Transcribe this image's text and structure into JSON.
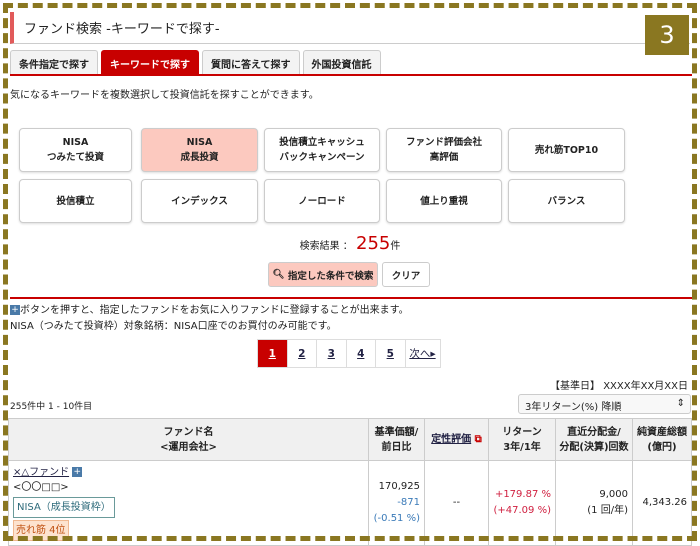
{
  "header": {
    "title": "ファンド検索 -キーワードで探す-",
    "badge": "3"
  },
  "tabs": [
    "条件指定で探す",
    "キーワードで探す",
    "質問に答えて探す",
    "外国投資信託"
  ],
  "description": "気になるキーワードを複数選択して投資信託を探すことができます。",
  "keywords": [
    {
      "l1": "NISA",
      "l2": "つみたて投資",
      "selected": false
    },
    {
      "l1": "NISA",
      "l2": "成長投資",
      "selected": true
    },
    {
      "l1": "投信積立キャッシュ",
      "l2": "バックキャンペーン",
      "selected": false
    },
    {
      "l1": "ファンド評価会社",
      "l2": "高評価",
      "selected": false
    },
    {
      "l1": "売れ筋TOP10",
      "l2": "",
      "selected": false
    },
    {
      "l1": "投信積立",
      "l2": "",
      "selected": false
    },
    {
      "l1": "インデックス",
      "l2": "",
      "selected": false
    },
    {
      "l1": "ノーロード",
      "l2": "",
      "selected": false
    },
    {
      "l1": "値上り重視",
      "l2": "",
      "selected": false
    },
    {
      "l1": "バランス",
      "l2": "",
      "selected": false
    }
  ],
  "result": {
    "label": "検索結果 ：",
    "count": "255",
    "unit": "件"
  },
  "buttons": {
    "search": "指定した条件で検索",
    "clear": "クリア"
  },
  "notes": [
    "ボタンを押すと、指定したファンドをお気に入りファンドに登録することが出来ます。",
    "NISA（つみたて投資枠）対象銘柄：NISA口座でのお買付のみ可能です。"
  ],
  "pager": {
    "pages": [
      "1",
      "2",
      "3",
      "4",
      "5"
    ],
    "next": "次へ▸",
    "current": "1"
  },
  "base_date": "【基準日】 XXXX年XX月XX日",
  "range": "255件中 1 - 10件目",
  "sort": "3年リターン(%) 降順",
  "table": {
    "headers": {
      "name1": "ファンド名",
      "name2": "<運用会社>",
      "price1": "基準価額/",
      "price2": "前日比",
      "rating": "定性評価",
      "ret1": "リターン",
      "ret2": "3年/1年",
      "dist1": "直近分配金/",
      "dist2": "分配(決算)回数",
      "assets1": "純資産総額",
      "assets2": "(億円)"
    },
    "rows": [
      {
        "name": "×△ファンド",
        "company": "<〇〇□□>",
        "nisa": "NISA（成長投資枠）",
        "rank": "売れ筋 4位",
        "price": "170,925",
        "change": "-871",
        "change_pct": "(-0.51 %)",
        "rating": "--",
        "ret3": "+179.87 %",
        "ret1": "(+47.09 %)",
        "dist": "9,000",
        "dist_count": "(1 回/年)",
        "assets": "4,343.26"
      }
    ]
  }
}
